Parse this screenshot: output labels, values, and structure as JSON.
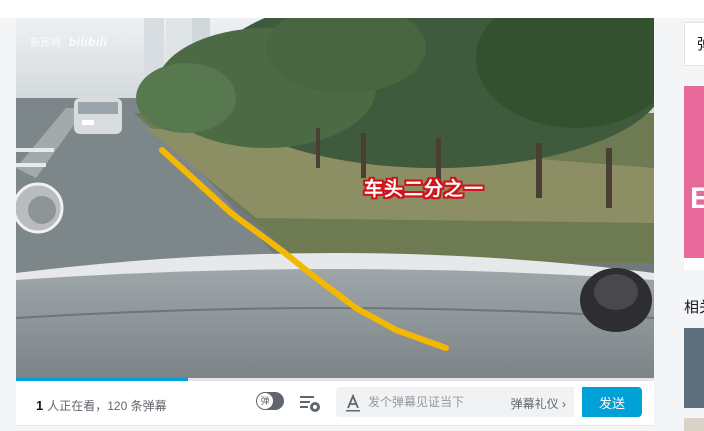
{
  "video": {
    "watermark_channel": "新民网",
    "watermark_logo": "bilibili",
    "caption": "车头二分之一",
    "progress_percent": 27
  },
  "controls": {
    "viewer_count": "1",
    "viewer_text": "人正在看，120 条弹幕",
    "toggle_glyph": "弹",
    "input_placeholder": "发个弹幕见证当下",
    "etiquette_label": "弹幕礼仪",
    "send_label": "发送"
  },
  "sidebar": {
    "top_card_text": "弹",
    "related_title": "相关推荐"
  },
  "colors": {
    "accent": "#00a1d6",
    "guide_line": "#f5b800",
    "caption_outline": "#d0121b"
  },
  "icons": [
    "a-icon",
    "danmaku-settings-icon",
    "chevron-right-icon",
    "mirror-icon",
    "camera-icon"
  ]
}
